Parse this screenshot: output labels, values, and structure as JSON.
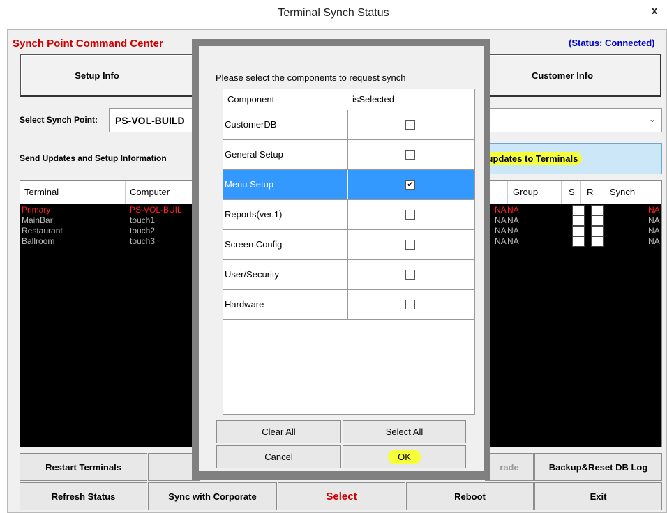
{
  "window": {
    "title": "Terminal Synch Status",
    "close_label": "x"
  },
  "header": {
    "command_center": "Synch Point Command Center",
    "status": "(Status: Connected)"
  },
  "tabs": {
    "setup_info": "Setup Info",
    "customer_info": "Customer Info"
  },
  "synch_point": {
    "label": "Select Synch Point:",
    "value": "PS-VOL-BUILD"
  },
  "send_updates": {
    "label": "Send Updates and Setup Information",
    "button": "d updates to Terminals"
  },
  "grid": {
    "headers": {
      "terminal": "Terminal",
      "computer": "Computer",
      "group": "Group",
      "s": "S",
      "r": "R",
      "synch": "Synch"
    },
    "rows": [
      {
        "terminal": "Primary",
        "computer": "PS-VOL-BUIL",
        "v": "NA",
        "group": "NA",
        "synch": "NA"
      },
      {
        "terminal": "MainBar",
        "computer": "touch1",
        "v": "NA",
        "group": "NA",
        "synch": "NA"
      },
      {
        "terminal": "Restaurant",
        "computer": "touch2",
        "v": "NA",
        "group": "NA",
        "synch": "NA"
      },
      {
        "terminal": "Ballroom",
        "computer": "touch3",
        "v": "NA",
        "group": "NA",
        "synch": "NA"
      }
    ]
  },
  "bottom_buttons": {
    "restart": "Restart Terminals",
    "upgrade_partial": "rade",
    "backup": "Backup&Reset DB Log",
    "refresh": "Refresh Status",
    "sync_corporate": "Sync with Corporate",
    "select": "Select",
    "reboot": "Reboot",
    "exit": "Exit"
  },
  "dialog": {
    "prompt": "Please select the components to request synch",
    "col_component": "Component",
    "col_selected": "isSelected",
    "rows": [
      {
        "name": "CustomerDB",
        "check": ""
      },
      {
        "name": "General Setup",
        "check": ""
      },
      {
        "name": "Menu Setup",
        "check": "✔"
      },
      {
        "name": "Reports(ver.1)",
        "check": ""
      },
      {
        "name": "Screen Config",
        "check": ""
      },
      {
        "name": "User/Security",
        "check": ""
      },
      {
        "name": "Hardware",
        "check": ""
      }
    ],
    "clear_all": "Clear All",
    "select_all": "Select All",
    "cancel": "Cancel",
    "ok": "OK"
  },
  "colors": {
    "selected_row": "#3399ff",
    "highlight": "#f5ff3a",
    "status_blue": "#0000cc",
    "alert_red": "#cc0000"
  }
}
